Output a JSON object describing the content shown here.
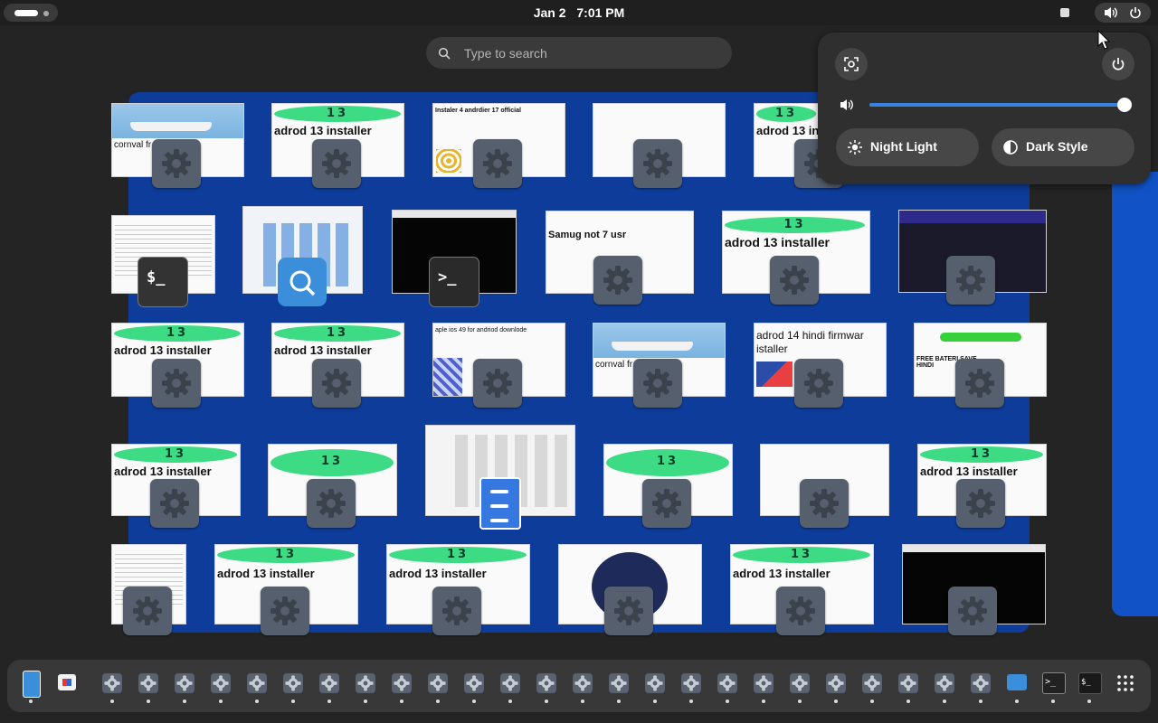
{
  "topbar": {
    "date": "Jan 2",
    "time": "7:01 PM"
  },
  "search": {
    "placeholder": "Type to search"
  },
  "windows": [
    {
      "title": "cornval fr"
    },
    {
      "title": "adrod 13 installer"
    },
    {
      "title": "Instaler 4 andrdier 17 official"
    },
    {
      "title": "adrod 13 installer"
    },
    {
      "title": "Samug not 7 usr"
    },
    {
      "title": "adrod 13 installer"
    },
    {
      "title": "adrod 13 installer"
    },
    {
      "title": "adrod 13 installer"
    },
    {
      "title": "aple ios 49 for andriod downlode"
    },
    {
      "title": "cornval fr"
    },
    {
      "title": "adrod 14 hindi firmwar istaller"
    },
    {
      "title": "FREE BATERI SAVE HINDI"
    },
    {
      "title": "adrod 13 installer"
    },
    {
      "title": "adrod 13 installer"
    },
    {
      "title": "adrod 13 installer"
    },
    {
      "title": "adrod 13 installer"
    },
    {
      "title": "adrod 13 installer"
    }
  ],
  "banner_text": "13",
  "quick_settings": {
    "volume_percent": 100,
    "night_light_label": "Night Light",
    "dark_style_label": "Dark Style"
  },
  "colors": {
    "accent": "#3584e4",
    "workspace": "#0d3c9a",
    "banner": "#3ddc84"
  }
}
